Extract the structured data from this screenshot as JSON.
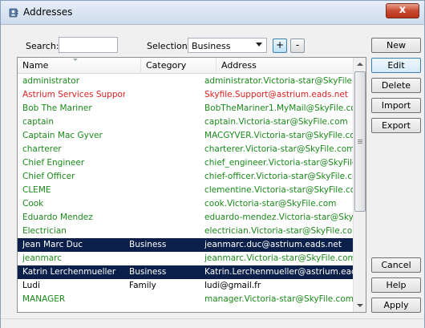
{
  "window": {
    "title": "Addresses",
    "close_glyph": "x"
  },
  "toolbar": {
    "search_label": "Search:",
    "search_value": "",
    "selection_label": "Selection:",
    "selection_value": "Business",
    "add_glyph": "+",
    "remove_glyph": "-"
  },
  "columns": {
    "name": "Name",
    "category": "Category",
    "address": "Address"
  },
  "rows": [
    {
      "name": "administrator",
      "category": "",
      "address": "administrator.Victoria-star@SkyFile.c...",
      "color": "#1a8a1a",
      "selected": false
    },
    {
      "name": "Astrium Services Support",
      "category": "",
      "address": "Skyfile.Support@astrium.eads.net",
      "color": "#e02020",
      "selected": false
    },
    {
      "name": "Bob The Mariner",
      "category": "",
      "address": "BobTheMariner1.MyMail@SkyFile.com",
      "color": "#1a8a1a",
      "selected": false
    },
    {
      "name": "captain",
      "category": "",
      "address": "captain.Victoria-star@SkyFile.com",
      "color": "#1a8a1a",
      "selected": false
    },
    {
      "name": "Captain Mac Gyver",
      "category": "",
      "address": "MACGYVER.Victoria-star@SkyFile.com",
      "color": "#1a8a1a",
      "selected": false
    },
    {
      "name": "charterer",
      "category": "",
      "address": "charterer.Victoria-star@SkyFile.com",
      "color": "#1a8a1a",
      "selected": false
    },
    {
      "name": "Chief Engineer",
      "category": "",
      "address": "chief_engineer.Victoria-star@SkyFile...",
      "color": "#1a8a1a",
      "selected": false
    },
    {
      "name": "Chief Officer",
      "category": "",
      "address": "chief-officer.Victoria-star@SkyFile.com",
      "color": "#1a8a1a",
      "selected": false
    },
    {
      "name": "CLEME",
      "category": "",
      "address": "clementine.Victoria-star@SkyFile.com",
      "color": "#1a8a1a",
      "selected": false
    },
    {
      "name": "Cook",
      "category": "",
      "address": "cook.Victoria-star@SkyFile.com",
      "color": "#1a8a1a",
      "selected": false
    },
    {
      "name": "Eduardo Mendez",
      "category": "",
      "address": "eduardo-mendez.Victoria-star@SkyF...",
      "color": "#1a8a1a",
      "selected": false
    },
    {
      "name": "Electrician",
      "category": "",
      "address": "electrician.Victoria-star@SkyFile.com",
      "color": "#1a8a1a",
      "selected": false
    },
    {
      "name": "Jean Marc Duc",
      "category": "Business",
      "address": "jeanmarc.duc@astrium.eads.net",
      "color": "#ffffff",
      "selected": true
    },
    {
      "name": "jeanmarc",
      "category": "",
      "address": "jeanmarc.Victoria-star@SkyFile.com",
      "color": "#1a8a1a",
      "selected": false
    },
    {
      "name": "Katrin Lerchenmueller",
      "category": "Business",
      "address": "Katrin.Lerchenmueller@astrium.eads...",
      "color": "#ffffff",
      "selected": true
    },
    {
      "name": "Ludi",
      "category": "Family",
      "address": "ludi@gmail.fr",
      "color": "#000000",
      "selected": false
    },
    {
      "name": "MANAGER",
      "category": "",
      "address": "manager.Victoria-star@SkyFile.com",
      "color": "#1a8a1a",
      "selected": false
    }
  ],
  "buttons": {
    "new": "New",
    "edit": "Edit",
    "delete": "Delete",
    "import": "Import",
    "export": "Export",
    "cancel": "Cancel",
    "help": "Help",
    "apply": "Apply"
  },
  "colors": {
    "selected_row": "#0b1f4b",
    "entry_green": "#1a8a1a",
    "entry_red": "#e02020"
  }
}
